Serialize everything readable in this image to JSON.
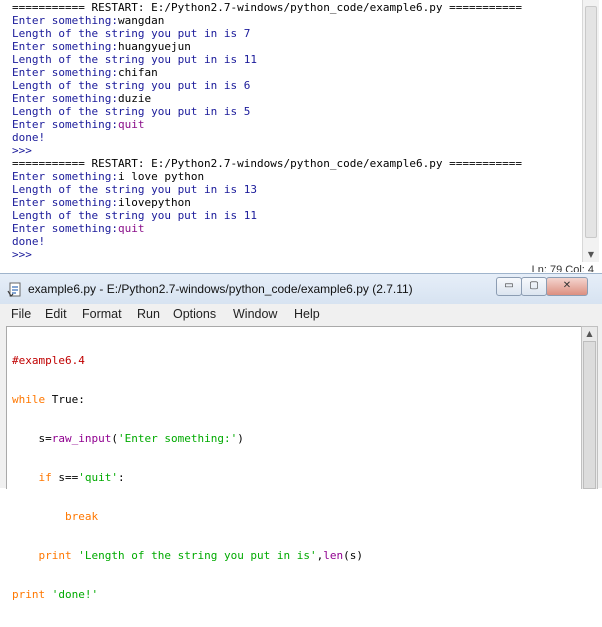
{
  "shell": {
    "lines": [
      {
        "text": "=========== RESTART: E:/Python2.7-windows/python_code/example6.py ===========",
        "kind": "restart"
      },
      {
        "prompt": "Enter something:",
        "input": "wangdan"
      },
      {
        "text": "Length of the string you put in is 7",
        "kind": "out"
      },
      {
        "prompt": "Enter something:",
        "input": "huangyuejun"
      },
      {
        "text": "Length of the string you put in is 11",
        "kind": "out"
      },
      {
        "prompt": "Enter something:",
        "input": "chifan"
      },
      {
        "text": "Length of the string you put in is 6",
        "kind": "out"
      },
      {
        "prompt": "Enter something:",
        "input": "duzie"
      },
      {
        "text": "Length of the string you put in is 5",
        "kind": "out"
      },
      {
        "prompt": "Enter something:",
        "input": "quit",
        "quit": true
      },
      {
        "text": "done!",
        "kind": "out"
      },
      {
        "text": ">>> ",
        "kind": "out"
      },
      {
        "text": "=========== RESTART: E:/Python2.7-windows/python_code/example6.py ===========",
        "kind": "restart"
      },
      {
        "prompt": "Enter something:",
        "input": "i love python"
      },
      {
        "text": "Length of the string you put in is 13",
        "kind": "out"
      },
      {
        "prompt": "Enter something:",
        "input": "ilovepython"
      },
      {
        "text": "Length of the string you put in is 11",
        "kind": "out"
      },
      {
        "prompt": "Enter something:",
        "input": "quit",
        "quit": true
      },
      {
        "text": "done!",
        "kind": "out"
      },
      {
        "text": ">>> ",
        "kind": "out"
      }
    ],
    "status": "Ln: 79   Col: 4"
  },
  "editor": {
    "title": "example6.py - E:/Python2.7-windows/python_code/example6.py (2.7.11)",
    "window_buttons": {
      "minimize": "▭",
      "maximize": "▢",
      "close": "✕"
    },
    "menu": [
      "File",
      "Edit",
      "Format",
      "Run",
      "Options",
      "Window",
      "Help"
    ],
    "code": {
      "l1": "#example6.4",
      "l2_kw": "while",
      "l2_rest": " True:",
      "l3_indent": "    s=",
      "l3_builtin": "raw_input",
      "l3_open": "(",
      "l3_str": "'Enter something:'",
      "l3_close": ")",
      "l4_indent": "    ",
      "l4_kw": "if",
      "l4_mid": " s==",
      "l4_str": "'quit'",
      "l4_end": ":",
      "l5_indent": "        ",
      "l5_kw": "break",
      "l6_indent": "    ",
      "l6_kw": "print",
      "l6_sp": " ",
      "l6_str": "'Length of the string you put in is'",
      "l6_comma": ",",
      "l6_builtin": "len",
      "l6_args": "(s)",
      "l7_kw": "print",
      "l7_sp": " ",
      "l7_str": "'done!'"
    }
  },
  "colors": {
    "output": "#1a1a9a",
    "keyword": "#ff7700",
    "builtin": "#900090",
    "string": "#00aa00",
    "comment": "#c00000"
  },
  "icons": {
    "title": "python-file-icon",
    "scroll_down": "arrow-down-icon",
    "scroll_up": "arrow-up-icon"
  }
}
